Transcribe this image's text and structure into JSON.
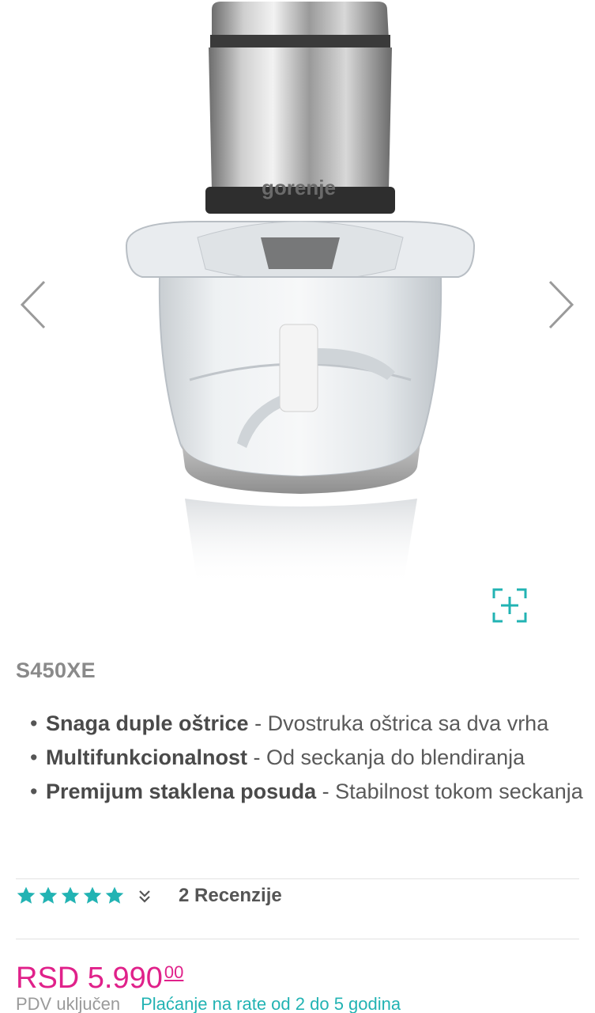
{
  "gallery": {
    "brand_label": "gorenje",
    "prev_icon": "chevron-left-icon",
    "next_icon": "chevron-right-icon",
    "zoom_icon": "zoom-expand-icon"
  },
  "product": {
    "model": "S450XE",
    "features": [
      {
        "title": "Snaga duple oštrice",
        "desc": " - Dvostruka oštrica sa dva vrha"
      },
      {
        "title": "Multifunkcionalnost",
        "desc": " - Od seckanja do blendiranja"
      },
      {
        "title": "Premijum staklena posuda",
        "desc": " - Stabilnost tokom seckanja"
      }
    ],
    "rating": {
      "stars": 5,
      "star_color": "#22b3b3",
      "reviews_label": "2 Recenzije"
    },
    "price": {
      "main": "RSD 5.990",
      "cents": "00",
      "color": "#e0218a"
    },
    "vat_note": "PDV uključen",
    "installments_link": "Plaćanje na rate od 2 do 5 godina"
  }
}
